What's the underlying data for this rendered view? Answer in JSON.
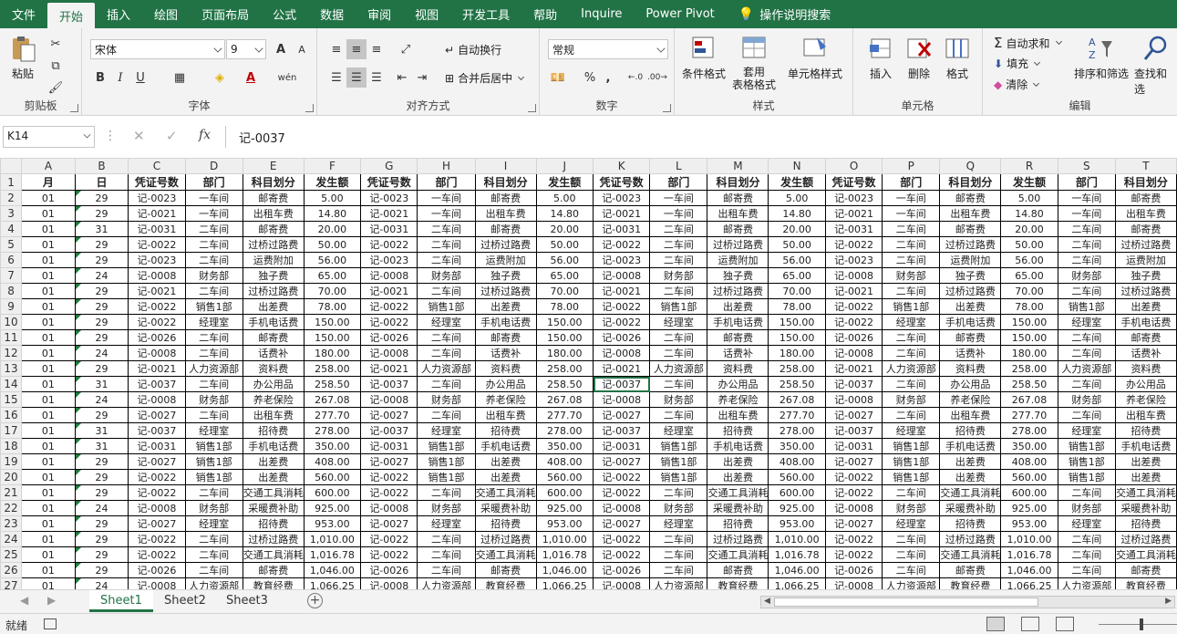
{
  "menu": {
    "tabs": [
      "文件",
      "开始",
      "插入",
      "绘图",
      "页面布局",
      "公式",
      "数据",
      "审阅",
      "视图",
      "开发工具",
      "帮助",
      "Inquire",
      "Power Pivot"
    ],
    "active": "开始",
    "search": "操作说明搜索"
  },
  "ribbon": {
    "clipboard": {
      "label": "剪贴板",
      "paste": "粘贴"
    },
    "font": {
      "label": "字体",
      "name": "宋体",
      "size": "9",
      "bold": "B",
      "italic": "I",
      "underline": "U",
      "grow": "A",
      "shrink": "A",
      "wen": "wén"
    },
    "alignment": {
      "label": "对齐方式",
      "wrap": "自动换行",
      "merge": "合并后居中"
    },
    "number": {
      "label": "数字",
      "format": "常规",
      "percent": "%",
      "comma": ","
    },
    "styles": {
      "label": "样式",
      "conditional": "条件格式",
      "table": "套用\n表格格式",
      "cell_styles": "单元格样式"
    },
    "cells": {
      "label": "单元格",
      "insert": "插入",
      "delete": "删除",
      "format": "格式"
    },
    "editing": {
      "label": "编辑",
      "autosum": "自动求和",
      "fill": "填充",
      "clear": "清除",
      "sort": "排序和筛选",
      "find": "查找和选"
    }
  },
  "formula_bar": {
    "name_box": "K14",
    "fx": "fx",
    "value": "记-0037"
  },
  "columns": [
    "A",
    "B",
    "C",
    "D",
    "E",
    "F",
    "G",
    "H",
    "I",
    "J",
    "K",
    "L",
    "M",
    "N",
    "O",
    "P",
    "Q",
    "R",
    "S",
    "T"
  ],
  "header_row": [
    "月",
    "日",
    "凭证号数",
    "部门",
    "科目划分",
    "发生额",
    "凭证号数",
    "部门",
    "科目划分",
    "发生额",
    "凭证号数",
    "部门",
    "科目划分",
    "发生额",
    "凭证号数",
    "部门",
    "科目划分",
    "发生额",
    "部门",
    "科目划分"
  ],
  "rows": [
    [
      "01",
      "29",
      "记-0023",
      "一车间",
      "邮寄费",
      "5.00"
    ],
    [
      "01",
      "29",
      "记-0021",
      "一车间",
      "出租车费",
      "14.80"
    ],
    [
      "01",
      "31",
      "记-0031",
      "二车间",
      "邮寄费",
      "20.00"
    ],
    [
      "01",
      "29",
      "记-0022",
      "二车间",
      "过桥过路费",
      "50.00"
    ],
    [
      "01",
      "29",
      "记-0023",
      "二车间",
      "运费附加",
      "56.00"
    ],
    [
      "01",
      "24",
      "记-0008",
      "财务部",
      "独子费",
      "65.00"
    ],
    [
      "01",
      "29",
      "记-0021",
      "二车间",
      "过桥过路费",
      "70.00"
    ],
    [
      "01",
      "29",
      "记-0022",
      "销售1部",
      "出差费",
      "78.00"
    ],
    [
      "01",
      "29",
      "记-0022",
      "经理室",
      "手机电话费",
      "150.00"
    ],
    [
      "01",
      "29",
      "记-0026",
      "二车间",
      "邮寄费",
      "150.00"
    ],
    [
      "01",
      "24",
      "记-0008",
      "二车间",
      "话费补",
      "180.00"
    ],
    [
      "01",
      "29",
      "记-0021",
      "人力资源部",
      "资料费",
      "258.00"
    ],
    [
      "01",
      "31",
      "记-0037",
      "二车间",
      "办公用品",
      "258.50"
    ],
    [
      "01",
      "24",
      "记-0008",
      "财务部",
      "养老保险",
      "267.08"
    ],
    [
      "01",
      "29",
      "记-0027",
      "二车间",
      "出租车费",
      "277.70"
    ],
    [
      "01",
      "31",
      "记-0037",
      "经理室",
      "招待费",
      "278.00"
    ],
    [
      "01",
      "31",
      "记-0031",
      "销售1部",
      "手机电话费",
      "350.00"
    ],
    [
      "01",
      "29",
      "记-0027",
      "销售1部",
      "出差费",
      "408.00"
    ],
    [
      "01",
      "29",
      "记-0022",
      "销售1部",
      "出差费",
      "560.00"
    ],
    [
      "01",
      "29",
      "记-0022",
      "二车间",
      "交通工具消耗",
      "600.00"
    ],
    [
      "01",
      "24",
      "记-0008",
      "财务部",
      "采暖费补助",
      "925.00"
    ],
    [
      "01",
      "29",
      "记-0027",
      "经理室",
      "招待费",
      "953.00"
    ],
    [
      "01",
      "29",
      "记-0022",
      "二车间",
      "过桥过路费",
      "1,010.00"
    ],
    [
      "01",
      "29",
      "记-0022",
      "二车间",
      "交通工具消耗",
      "1,016.78"
    ],
    [
      "01",
      "29",
      "记-0026",
      "二车间",
      "邮寄费",
      "1,046.00"
    ],
    [
      "01",
      "24",
      "记-0008",
      "人力资源部",
      "教育经费",
      "1,066.25"
    ]
  ],
  "sheets": [
    "Sheet1",
    "Sheet2",
    "Sheet3"
  ],
  "active_sheet": "Sheet1",
  "status": {
    "text": "就绪"
  }
}
